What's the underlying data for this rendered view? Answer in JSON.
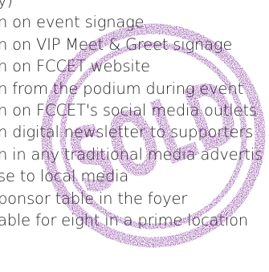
{
  "benefits": [
    "y)",
    "n on event signage",
    "n on VIP Meet & Greet signage",
    "n on FCCET website",
    "n from the podium during event",
    "n on FCCET's social media outlets",
    "n digital newsletter to supporters",
    "n in any traditional media advertis",
    "se to local media",
    "ponsor table in the foyer",
    "able for eight in a prime location"
  ],
  "stamp": {
    "text": "SOLD",
    "color": "#7b2a93"
  }
}
